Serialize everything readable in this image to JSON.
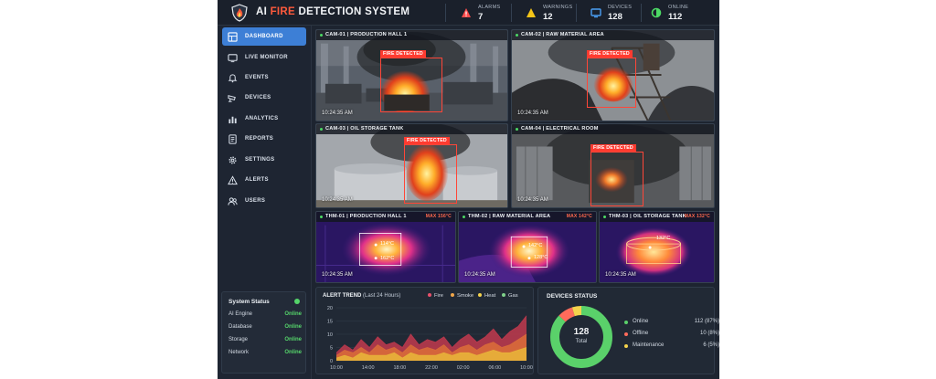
{
  "header": {
    "title_prefix": "AI ",
    "title_accent": "FIRE",
    "title_suffix": " DETECTION SYSTEM",
    "stats": [
      {
        "label": "ALARMS",
        "value": "7",
        "icon": "alert-triangle-icon",
        "color": "#ff4d4d"
      },
      {
        "label": "WARNINGS",
        "value": "12",
        "icon": "warning-triangle-icon",
        "color": "#f5c518"
      },
      {
        "label": "DEVICES",
        "value": "128",
        "icon": "monitor-icon",
        "color": "#4a9ff5"
      },
      {
        "label": "ONLINE",
        "value": "112",
        "icon": "online-icon",
        "color": "#4cd964"
      }
    ]
  },
  "sidebar": {
    "items": [
      {
        "label": "DASHBOARD",
        "icon": "dashboard-icon",
        "active": true
      },
      {
        "label": "LIVE MONITOR",
        "icon": "monitor-icon",
        "active": false
      },
      {
        "label": "EVENTS",
        "icon": "bell-icon",
        "active": false
      },
      {
        "label": "DEVICES",
        "icon": "camera-icon",
        "active": false
      },
      {
        "label": "ANALYTICS",
        "icon": "bar-chart-icon",
        "active": false
      },
      {
        "label": "REPORTS",
        "icon": "report-icon",
        "active": false
      },
      {
        "label": "SETTINGS",
        "icon": "gear-icon",
        "active": false
      },
      {
        "label": "ALERTS",
        "icon": "alert-icon",
        "active": false
      },
      {
        "label": "USERS",
        "icon": "users-icon",
        "active": false
      }
    ],
    "system_status": {
      "title": "System Status",
      "rows": [
        {
          "name": "AI Engine",
          "status": "Online"
        },
        {
          "name": "Database",
          "status": "Online"
        },
        {
          "name": "Storage",
          "status": "Online"
        },
        {
          "name": "Network",
          "status": "Online"
        }
      ]
    }
  },
  "cameras": [
    {
      "label": "CAM-01 | PRODUCTION HALL 1",
      "time": "10:24:35 AM",
      "tag": "FIRE DETECTED"
    },
    {
      "label": "CAM-02 | RAW MATERIAL AREA",
      "time": "10:24:35 AM",
      "tag": "FIRE DETECTED"
    },
    {
      "label": "CAM-03 | OIL STORAGE TANK",
      "time": "10:24:35 AM",
      "tag": "FIRE DETECTED"
    },
    {
      "label": "CAM-04 | ELECTRICAL ROOM",
      "time": "10:24:35 AM",
      "tag": "FIRE DETECTED"
    }
  ],
  "thermals": [
    {
      "label": "THM-01 | PRODUCTION HALL 1",
      "max": "MAX 156°C",
      "time": "10:24:35 AM",
      "readings": [
        "114°C",
        "162°C"
      ]
    },
    {
      "label": "THM-02 | RAW MATERIAL AREA",
      "max": "MAX 142°C",
      "time": "10:24:35 AM",
      "readings": [
        "142°C",
        "128°C"
      ]
    },
    {
      "label": "THM-03 | OIL STORAGE TANK",
      "max": "MAX 132°C",
      "time": "10:24:35 AM",
      "readings": [
        "132°C"
      ]
    }
  ],
  "alert_trend": {
    "title": "ALERT TREND",
    "subtitle": "(Last 24 Hours)",
    "legend": [
      {
        "name": "Fire",
        "color": "#e8506a"
      },
      {
        "name": "Smoke",
        "color": "#f0a64a"
      },
      {
        "name": "Heat",
        "color": "#f5d34c"
      },
      {
        "name": "Gas",
        "color": "#7fd18b"
      }
    ]
  },
  "chart_data": {
    "type": "area",
    "title": "ALERT TREND",
    "subtitle": "(Last 24 Hours)",
    "xlabel": "",
    "ylabel": "",
    "x_ticks": [
      "10:00",
      "14:00",
      "18:00",
      "22:00",
      "02:00",
      "06:00",
      "10:00"
    ],
    "y_ticks": [
      0,
      5,
      10,
      15,
      20
    ],
    "ylim": [
      0,
      20
    ],
    "grid": true,
    "legend_position": "top-right",
    "series": [
      {
        "name": "Fire",
        "color": "#b8384c",
        "values": [
          3,
          6,
          4,
          8,
          5,
          9,
          6,
          7,
          5,
          10,
          6,
          8,
          7,
          9,
          5,
          8,
          10,
          7,
          9,
          12,
          8,
          11,
          13,
          17
        ]
      },
      {
        "name": "Smoke",
        "color": "#d86a3a",
        "values": [
          2,
          4,
          3,
          5,
          3,
          6,
          4,
          5,
          3,
          6,
          4,
          5,
          4,
          6,
          3,
          5,
          6,
          4,
          6,
          7,
          5,
          6,
          8,
          10
        ]
      },
      {
        "name": "Heat",
        "color": "#e8b23a",
        "values": [
          1,
          2,
          1,
          3,
          2,
          2,
          2,
          3,
          1,
          3,
          2,
          2,
          2,
          3,
          2,
          3,
          3,
          2,
          3,
          4,
          3,
          3,
          4,
          5
        ]
      }
    ]
  },
  "devices_status": {
    "title": "DEVICES STATUS",
    "total": "128",
    "total_label": "Total",
    "rows": [
      {
        "name": "Online",
        "value": "112 (87%)",
        "color": "#5ad16a",
        "share": 0.87
      },
      {
        "name": "Offline",
        "value": "10 (8%)",
        "color": "#ff6b5b",
        "share": 0.08
      },
      {
        "name": "Maintenance",
        "value": "6 (5%)",
        "color": "#f5d34c",
        "share": 0.05
      }
    ]
  },
  "colors": {
    "accent": "#3d7fd6",
    "fire": "#ff5a3c",
    "online": "#55d46a"
  }
}
